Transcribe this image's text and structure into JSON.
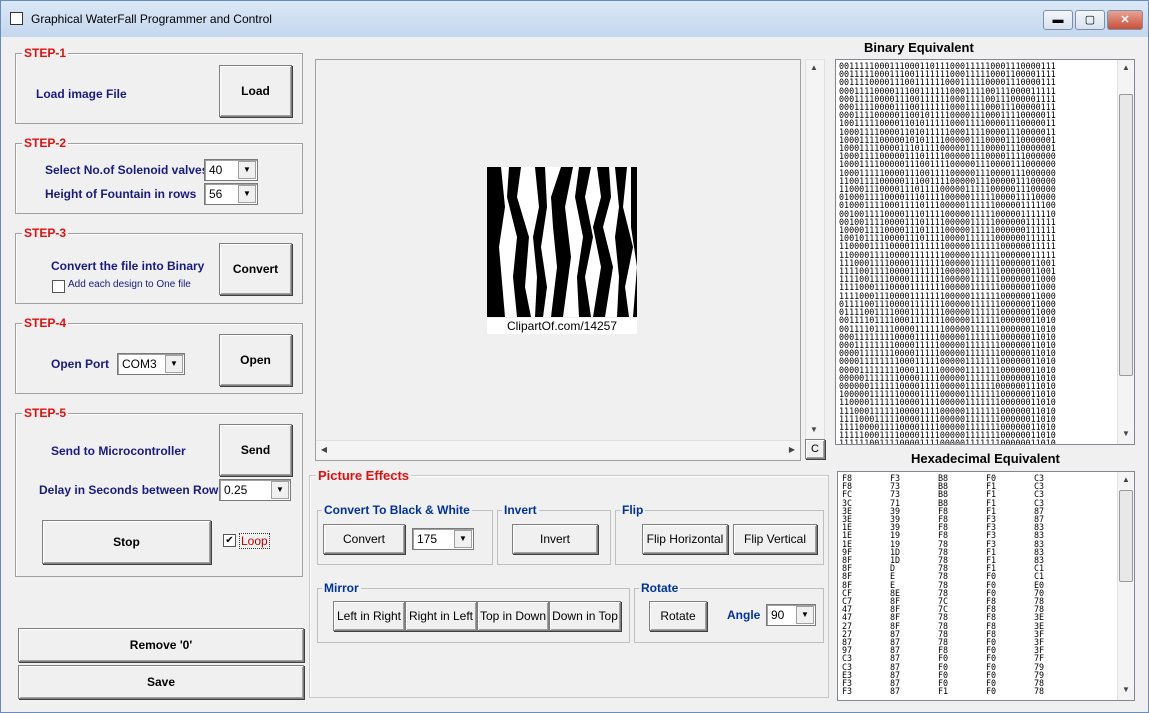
{
  "window": {
    "title": "Graphical WaterFall Programmer and Control",
    "minimize": "▬",
    "maximize": "▢",
    "close": "✕"
  },
  "step1": {
    "title": "STEP-1",
    "label": "Load image File",
    "button": "Load"
  },
  "step2": {
    "title": "STEP-2",
    "solenoid_label": "Select No.of Solenoid valves",
    "solenoid_value": "40",
    "height_label": "Height of Fountain in rows",
    "height_value": "56"
  },
  "step3": {
    "title": "STEP-3",
    "label": "Convert the file into Binary",
    "button": "Convert",
    "checkbox_label": "Add each design to One file"
  },
  "step4": {
    "title": "STEP-4",
    "label": "Open Port",
    "port_value": "COM3",
    "button": "Open"
  },
  "step5": {
    "title": "STEP-5",
    "label": "Send to Microcontroller",
    "button": "Send",
    "delay_label": "Delay in Seconds between Rows",
    "delay_value": "0.25",
    "stop_button": "Stop",
    "loop_label": "Loop",
    "loop_checked": "✔"
  },
  "bottom": {
    "remove_button": "Remove '0'",
    "save_button": "Save"
  },
  "preview": {
    "caption": "ClipartOf.com/14257",
    "c_button": "C"
  },
  "effects": {
    "title": "Picture Effects",
    "bw_group": "Convert To Black & White",
    "bw_button": "Convert",
    "bw_value": "175",
    "invert_group": "Invert",
    "invert_button": "Invert",
    "flip_group": "Flip",
    "flip_h": "Flip Horizontal",
    "flip_v": "Flip Vertical",
    "mirror_group": "Mirror",
    "mirror_lr": "Left in Right",
    "mirror_rl": "Right in Left",
    "mirror_td": "Top in Down",
    "mirror_dt": "Down in Top",
    "rotate_group": "Rotate",
    "rotate_button": "Rotate",
    "angle_label": "Angle",
    "angle_value": "90"
  },
  "binary": {
    "title": "Binary Equivalent",
    "lines": [
      "0011111000111000110111000111110001110000111",
      "0011111000111001111111000111110001100001111",
      "0011110000111001111110001111100001110000111",
      "0001111000011100111111000111100111000011111",
      "0001111000011100111111000111100111000001111",
      "0001111000011100111111000111100011100000111",
      "0001111000001100101111000011100011110000011",
      "1001111100001101011111000111100001110000011",
      "1000111100001101011111000111100001110000011",
      "1000111100000101011110000011100001110000001",
      "1000111100001110111100000111100001110000001",
      "1000111100000111011110000011100001111000000",
      "1000111100000111001111000001110000111000000",
      "1000111110000111001111000001110000111000000",
      "1100111100000111001111000001110000011100000",
      "1100011100001110111100000111110000011100000",
      "0100011110000111011110000011111000011110000",
      "0100011110001111011100000111111000001111100",
      "0010011110000111011110000011111000001111110",
      "0010011110000111011110000011111000000111111",
      "1000011110000111011110000011111000000111111",
      "1001011110000111011110000111111000000111111",
      "1100001111000011111110000011111100000011111",
      "1100001111000011111110000011111100000011111",
      "1110001111000011111110000011111100000011001",
      "1111001111000011111110000011111100000011001",
      "1111001111000011111110000011111100000011000",
      "1111000111000011111110000011111100000011000",
      "1111000111000011111110000011111100000011000",
      "0111100111000011111110000011111100000011000",
      "0111100111100011111110000011111100000011000",
      "0011110111100011111110000011111100000011010",
      "0011110111100001111110000011111100000011010",
      "0001111111100001111100000111111100000011010",
      "0001111111100001111100000111111100000011010",
      "0000111111100001111100000111111100000011010",
      "0000111111110001111100000111111100000011010",
      "0000111111110001111100000111111100000011010",
      "0000011111110000111100000111111100000011010",
      "0000001111110000111100000111111000000111010",
      "1000001111110000111100000111111100000011010",
      "1100001111110000111100000111111100000011010",
      "1110001111110000111100000111111100000011010",
      "1111000111110000111100000111111100000011010",
      "1111000011110000111100000111111100000011010",
      "1111100011110000111100000111111100000011010",
      "1111110011110000111100000111111100000011010",
      "1111110011110000111100000111111100000011010"
    ]
  },
  "hex": {
    "title": "Hexadecimal Equivalent",
    "rows": [
      [
        "F8",
        "F3",
        "B8",
        "F0",
        "C3"
      ],
      [
        "F8",
        "73",
        "B8",
        "F1",
        "C3"
      ],
      [
        "FC",
        "73",
        "B8",
        "F1",
        "C3"
      ],
      [
        "3C",
        "71",
        "B8",
        "F1",
        "C3"
      ],
      [
        "3E",
        "39",
        "F8",
        "F1",
        "87"
      ],
      [
        "3E",
        "39",
        "F8",
        "F3",
        "87"
      ],
      [
        "1E",
        "39",
        "F8",
        "F3",
        "83"
      ],
      [
        "1E",
        "19",
        "F8",
        "F3",
        "83"
      ],
      [
        "1E",
        "19",
        "78",
        "F3",
        "83"
      ],
      [
        "9F",
        "1D",
        "78",
        "F1",
        "83"
      ],
      [
        "8F",
        "1D",
        "78",
        "F1",
        "83"
      ],
      [
        "8F",
        "D",
        "78",
        "F1",
        "C1"
      ],
      [
        "8F",
        "E",
        "78",
        "F0",
        "C1"
      ],
      [
        "8F",
        "E",
        "78",
        "F0",
        "E0"
      ],
      [
        "CF",
        "8E",
        "78",
        "F0",
        "70"
      ],
      [
        "C7",
        "8F",
        "7C",
        "F8",
        "78"
      ],
      [
        "47",
        "8F",
        "7C",
        "F8",
        "78"
      ],
      [
        "47",
        "8F",
        "78",
        "F8",
        "3E"
      ],
      [
        "27",
        "8F",
        "78",
        "F8",
        "3E"
      ],
      [
        "27",
        "87",
        "78",
        "F8",
        "3F"
      ],
      [
        "87",
        "87",
        "78",
        "F0",
        "3F"
      ],
      [
        "97",
        "87",
        "F8",
        "F0",
        "3F"
      ],
      [
        "C3",
        "87",
        "F0",
        "F0",
        "7F"
      ],
      [
        "C3",
        "87",
        "F0",
        "F0",
        "79"
      ],
      [
        "E3",
        "87",
        "F0",
        "F0",
        "79"
      ],
      [
        "F3",
        "87",
        "F0",
        "F0",
        "78"
      ],
      [
        "F3",
        "87",
        "F1",
        "F0",
        "78"
      ]
    ]
  }
}
